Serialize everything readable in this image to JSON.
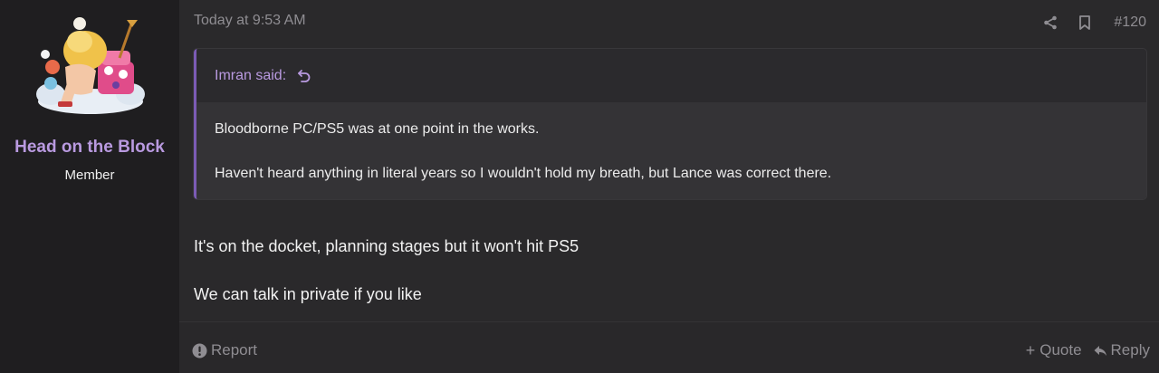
{
  "user": {
    "name": "Head on the Block",
    "title": "Member",
    "avatar_icon": "cartoon-avatar-image"
  },
  "post": {
    "timestamp": "Today at 9:53 AM",
    "number": "#120",
    "share_icon": "share-icon",
    "bookmark_icon": "bookmark-icon"
  },
  "quote": {
    "author_label": "Imran said:",
    "jump_icon": "jump-to-quote-icon",
    "lines": [
      "Bloodborne PC/PS5 was at one point in the works.",
      "Haven't heard anything in literal years so I wouldn't hold my breath, but Lance was correct there."
    ]
  },
  "message": {
    "lines": [
      "It's on the docket, planning stages but it won't hit PS5",
      "We can talk in private if you like"
    ]
  },
  "footer": {
    "report_label": "Report",
    "quote_label": "Quote",
    "reply_label": "Reply",
    "quote_prefix": "+"
  },
  "colors": {
    "accent": "#b99ae0",
    "quote_border": "#7b5bb5",
    "muted": "#8f8d92",
    "background": "#2a292b",
    "sidebar": "#1f1e20"
  }
}
